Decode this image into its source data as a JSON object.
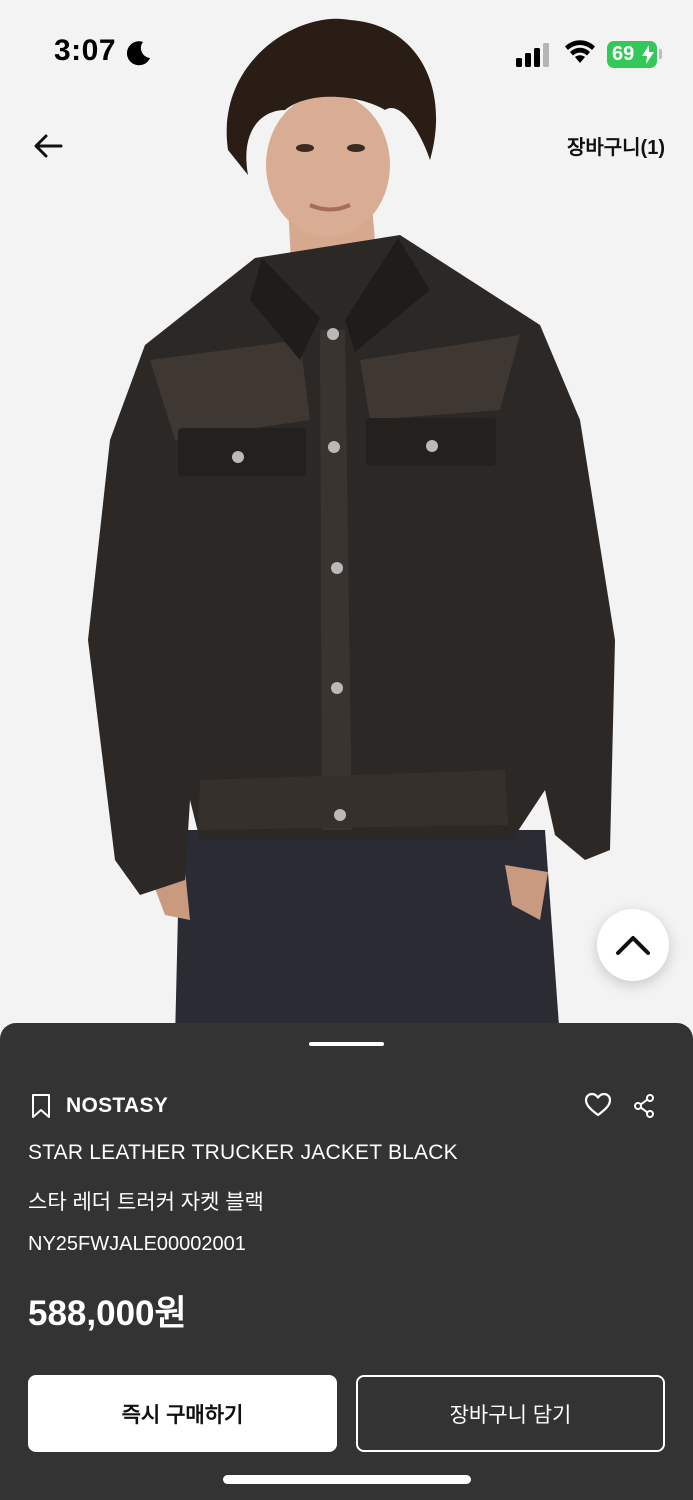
{
  "status_bar": {
    "time": "3:07",
    "battery": "69"
  },
  "nav": {
    "back_icon": "arrow-left-icon",
    "cart_label": "장바구니(1)"
  },
  "product": {
    "image": "model-wearing-black-leather-trucker-jacket",
    "brand": "NOSTASY",
    "name_en": "STAR LEATHER TRUCKER JACKET BLACK",
    "name_ko": "스타 레더 트러커 자켓 블랙",
    "code": "NY25FWJALE00002001",
    "price": "588,000원"
  },
  "actions": {
    "buy_now_label": "즉시 구매하기",
    "add_to_cart_label": "장바구니 담기"
  },
  "colors": {
    "sheet_bg": "#333333",
    "battery": "#34c759",
    "photo_bg": "#f3f3f3"
  }
}
